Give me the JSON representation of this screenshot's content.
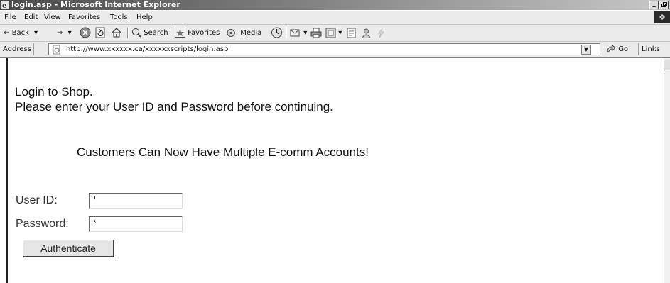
{
  "window": {
    "title": "login.asp - Microsoft Internet Explorer",
    "minimize": "_",
    "restore": "1"
  },
  "menu": [
    "File",
    "Edit",
    "View",
    "Favorites",
    "Tools",
    "Help"
  ],
  "toolbar": {
    "back": "Back",
    "search": "Search",
    "favorites": "Favorites",
    "media": "Media"
  },
  "address": {
    "label": "Address",
    "url": "http://www.xxxxxx.ca/xxxxxxscripts/login.asp",
    "go": "Go",
    "links": "Links"
  },
  "page": {
    "heading": "Login to Shop.",
    "subheading": "Please enter your User ID and Password before continuing.",
    "announcement": "Customers Can Now Have Multiple E-comm Accounts!",
    "userid_label": "User ID:",
    "userid_value": "'",
    "password_label": "Password:",
    "password_value": "*",
    "submit_label": "Authenticate"
  }
}
